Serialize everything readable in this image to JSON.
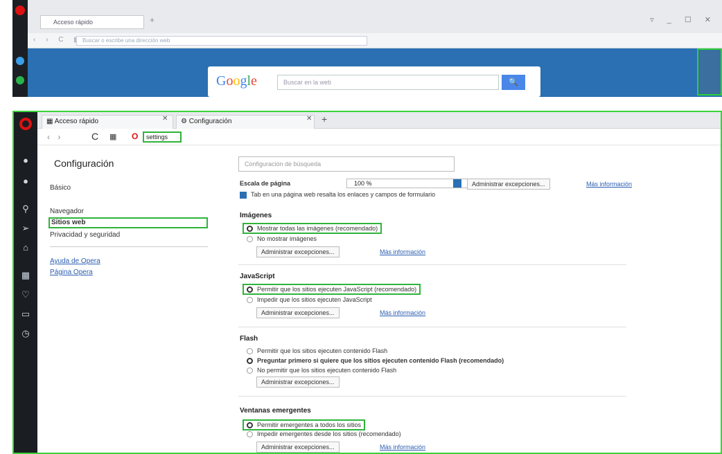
{
  "top": {
    "tab_label": "Acceso rápido",
    "new_tab": "+",
    "window_controls": "▿ _ ☐ ✕",
    "url": "Buscar o escribe una dirección web",
    "google": {
      "logo": "Google",
      "search_placeholder": "Buscar en la web",
      "search_button": "🔍"
    }
  },
  "tabs": [
    {
      "label": "Acceso rápido",
      "close": "✕"
    },
    {
      "label": "Configuración",
      "close": "✕"
    }
  ],
  "new_tab": "+",
  "address": {
    "back": "‹ ›",
    "reload": "C",
    "grid": "▦",
    "logo": "O",
    "url": "settings"
  },
  "leftnav": {
    "title": "Configuración",
    "items": [
      "Básico",
      "Navegador",
      "Sitios web",
      "Privacidad y seguridad"
    ],
    "links": [
      "Ayuda de Opera",
      "Página Opera"
    ]
  },
  "content": {
    "search_placeholder": "Configuración de búsqueda",
    "zoom_label": "Escala de página",
    "zoom_value": "100 %",
    "zoom_manage": "Administrar excepciones...",
    "zoom_more": "Más información",
    "tab_links": "Tab en una página web resalta los enlaces y campos de formulario",
    "sections": [
      {
        "title": "Imágenes",
        "options": [
          "Mostrar todas las imágenes (recomendado)",
          "No mostrar imágenes"
        ],
        "selected": 0,
        "button": "Administrar excepciones...",
        "link": "Más información"
      },
      {
        "title": "JavaScript",
        "options": [
          "Permitir que los sitios ejecuten JavaScript (recomendado)",
          "Impedir que los sitios ejecuten JavaScript"
        ],
        "selected": 0,
        "button": "Administrar excepciones...",
        "link": "Más información"
      },
      {
        "title": "Flash",
        "options": [
          "Permitir que los sitios ejecuten contenido Flash",
          "Preguntar primero si quiere que los sitios ejecuten contenido Flash (recomendado)",
          "No permitir que los sitios ejecuten contenido Flash"
        ],
        "selected": 1,
        "button": "Administrar excepciones..."
      },
      {
        "title": "Ventanas emergentes",
        "options": [
          "Permitir emergentes a todos los sitios",
          "Impedir emergentes desde los sitios (recomendado)"
        ],
        "selected": 0,
        "button": "Administrar excepciones...",
        "link": "Más información"
      }
    ]
  }
}
